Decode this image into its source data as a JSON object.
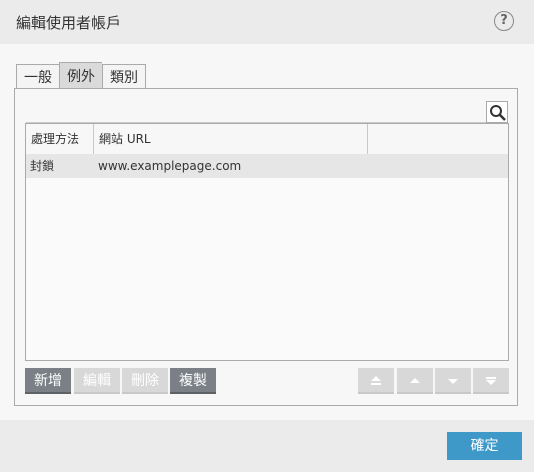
{
  "dialog": {
    "title": "編輯使用者帳戶",
    "help_label": "?"
  },
  "tabs": [
    {
      "label": "一般",
      "active": false
    },
    {
      "label": "例外",
      "active": true
    },
    {
      "label": "類別",
      "active": false
    }
  ],
  "table": {
    "columns": [
      "處理方法",
      "網站 URL",
      ""
    ],
    "rows": [
      {
        "action": "封鎖",
        "url": "www.examplepage.com"
      }
    ]
  },
  "buttons": {
    "add": "新增",
    "edit": "編輯",
    "delete": "刪除",
    "copy": "複製"
  },
  "footer": {
    "ok_label": "確定"
  },
  "colors": {
    "accent": "#3f99c8",
    "dark_button": "#7a8086",
    "disabled_button": "#d8d8d8"
  },
  "icons": {
    "search": "search-icon",
    "top": "move-top-icon",
    "up": "move-up-icon",
    "down": "move-down-icon",
    "bottom": "move-bottom-icon"
  }
}
